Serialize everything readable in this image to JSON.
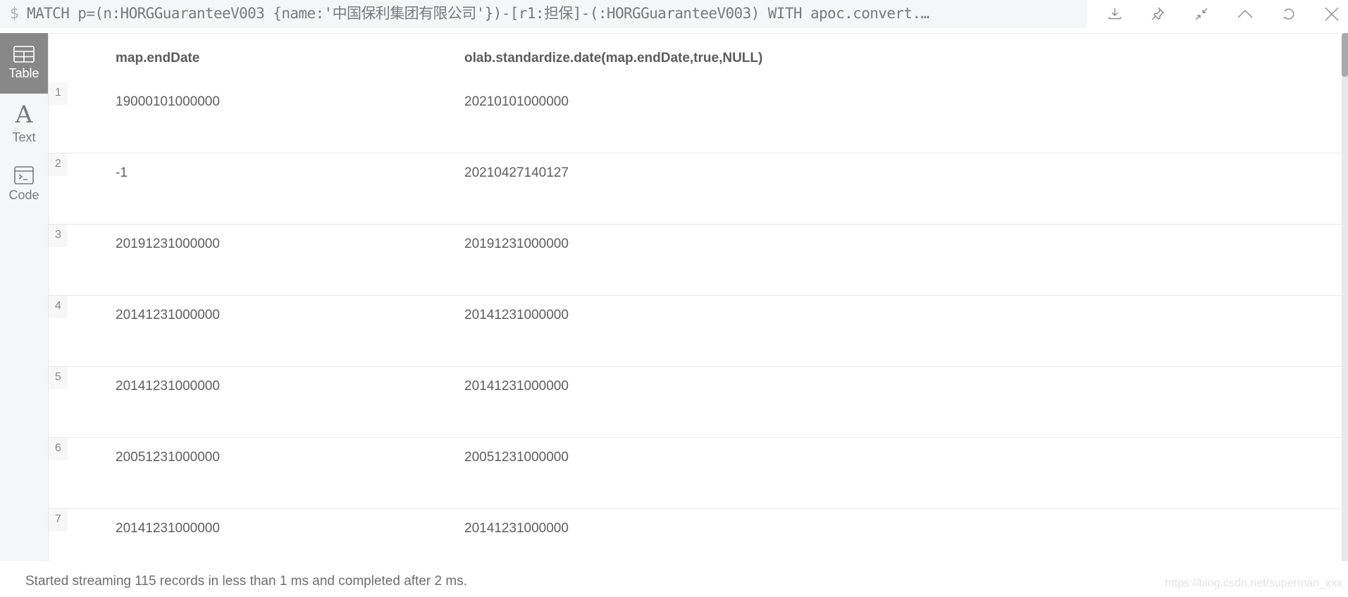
{
  "query": {
    "prompt": "$",
    "text": "MATCH p=(n:HORGGuaranteeV003 {name:'中国保利集团有限公司'})-[r1:担保]-(:HORGGuaranteeV003) WITH apoc.convert.…"
  },
  "actions": [
    {
      "name": "download-icon",
      "label": "Export"
    },
    {
      "name": "pin-icon",
      "label": "Pin"
    },
    {
      "name": "collapse-icon",
      "label": "Minimize"
    },
    {
      "name": "chevron-up-icon",
      "label": "Collapse"
    },
    {
      "name": "rerun-icon",
      "label": "Rerun"
    },
    {
      "name": "close-icon",
      "label": "Close"
    }
  ],
  "sidebar": {
    "items": [
      {
        "label": "Table",
        "icon": "table-icon",
        "active": true
      },
      {
        "label": "Text",
        "icon": "text-icon",
        "glyph": "A",
        "active": false
      },
      {
        "label": "Code",
        "icon": "code-icon",
        "active": false
      }
    ]
  },
  "table": {
    "columns": [
      "map.endDate",
      "olab.standardize.date(map.endDate,true,NULL)"
    ],
    "rows": [
      {
        "num": "1",
        "cells": [
          "19000101000000",
          "20210101000000"
        ]
      },
      {
        "num": "2",
        "cells": [
          "-1",
          "20210427140127"
        ]
      },
      {
        "num": "3",
        "cells": [
          "20191231000000",
          "20191231000000"
        ]
      },
      {
        "num": "4",
        "cells": [
          "20141231000000",
          "20141231000000"
        ]
      },
      {
        "num": "5",
        "cells": [
          "20141231000000",
          "20141231000000"
        ]
      },
      {
        "num": "6",
        "cells": [
          "20051231000000",
          "20051231000000"
        ]
      },
      {
        "num": "7",
        "cells": [
          "20141231000000",
          "20141231000000"
        ]
      }
    ]
  },
  "footer": {
    "status": "Started streaming 115 records in less than 1 ms and completed after 2 ms."
  },
  "watermark": "https://blog.csdn.net/superman_xxx"
}
